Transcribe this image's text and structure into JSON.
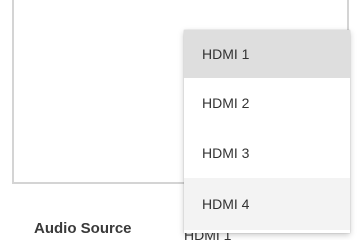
{
  "audio_source": {
    "label": "Audio Source",
    "selected_value": "HDMI 1"
  },
  "dropdown": {
    "options": [
      {
        "label": "HDMI 1",
        "state": "selected"
      },
      {
        "label": "HDMI 2",
        "state": "default"
      },
      {
        "label": "HDMI 3",
        "state": "default"
      },
      {
        "label": "HDMI 4",
        "state": "hover"
      }
    ]
  },
  "colors": {
    "selected_bg": "#dedede",
    "hover_bg": "#f3f3f3",
    "text": "#333333",
    "border": "#d4d4d4"
  }
}
